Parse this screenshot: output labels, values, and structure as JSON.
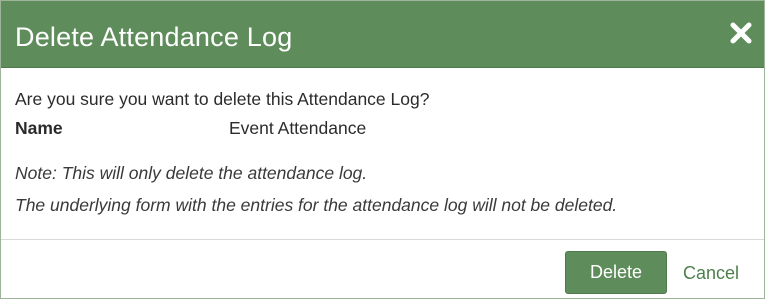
{
  "dialog": {
    "title": "Delete Attendance Log",
    "close_icon": "close-icon",
    "question": "Are you sure you want to delete this Attendance Log?",
    "name_label": "Name",
    "name_value": "Event Attendance",
    "note_line1": "Note: This will only delete the attendance log.",
    "note_line2": "The underlying form with the entries for the attendance log will not be deleted.",
    "delete_label": "Delete",
    "cancel_label": "Cancel"
  },
  "colors": {
    "header_bg": "#5e8d5b",
    "button_bg": "#5e8d5b",
    "link": "#4e7f4b",
    "text": "#2b2b2b"
  }
}
